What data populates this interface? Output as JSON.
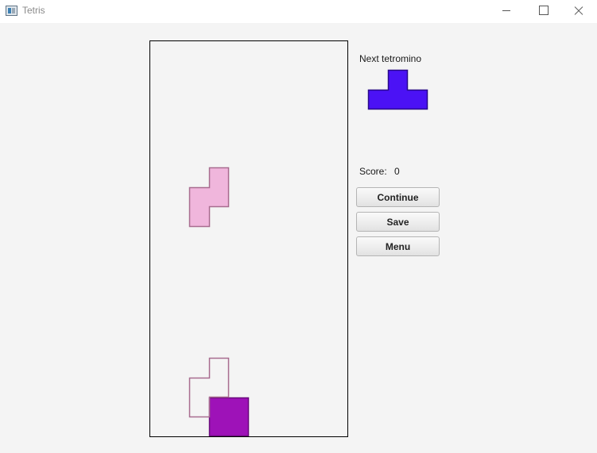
{
  "window": {
    "title": "Tetris"
  },
  "board": {
    "columns": 10,
    "rows": 20,
    "cell_size": 25,
    "active_piece": {
      "shape": "S",
      "color": "#f0b6dc",
      "border": "#a86c8f",
      "cells": [
        [
          3,
          6
        ],
        [
          3,
          7
        ],
        [
          2,
          7
        ],
        [
          2,
          8
        ],
        [
          3,
          8
        ],
        [
          2,
          9
        ]
      ]
    },
    "ghost_piece": {
      "shape": "S",
      "border": "#a86c8f",
      "cells": [
        [
          3,
          16
        ],
        [
          3,
          17
        ],
        [
          2,
          17
        ],
        [
          2,
          18
        ],
        [
          3,
          18
        ],
        [
          2,
          19
        ]
      ]
    },
    "locked_blocks": [
      {
        "cells": [
          [
            3,
            18
          ],
          [
            4,
            18
          ],
          [
            3,
            19
          ],
          [
            4,
            19
          ]
        ],
        "color": "#9e12b8",
        "border": "#6a0a7c"
      }
    ]
  },
  "side_panel": {
    "next_label": "Next tetromino",
    "next_piece": {
      "shape": "T",
      "color": "#4b12f5",
      "border": "#2a0a8a"
    },
    "score_label": "Score:",
    "score_value": "0"
  },
  "buttons": {
    "continue_label": "Continue",
    "save_label": "Save",
    "menu_label": "Menu"
  }
}
